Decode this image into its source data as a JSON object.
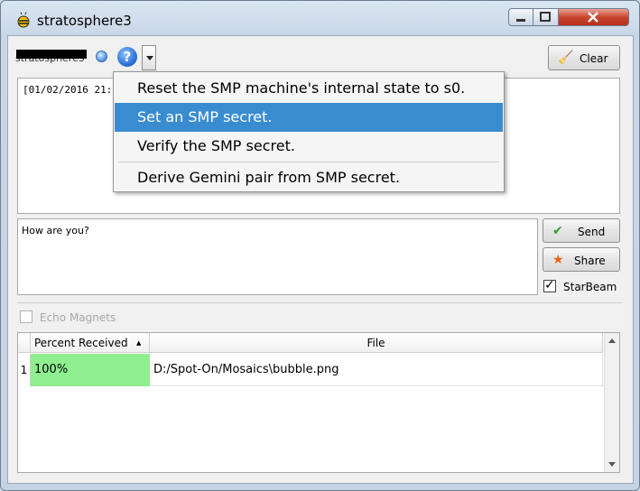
{
  "window": {
    "title": "stratosphere3",
    "controls": [
      "minimize",
      "maximize",
      "close"
    ]
  },
  "toolbar": {
    "participant_name": "stratosphere3",
    "status_icon": "blue-orb-icon",
    "help_icon": "help-icon",
    "clear_label": "Clear"
  },
  "history": {
    "first_line": "[01/02/2016 21:0"
  },
  "compose": {
    "text": "How are you?",
    "send_label": "Send",
    "share_label": "Share",
    "starbeam_label": "StarBeam",
    "starbeam_checked": true
  },
  "echo_magnets": {
    "label": "Echo Magnets",
    "enabled": false
  },
  "table": {
    "columns": [
      "Percent Received",
      "File"
    ],
    "rows": [
      {
        "index": "1",
        "percent": "100%",
        "file": "D:/Spot-On/Mosaics\\bubble.png"
      }
    ]
  },
  "smp_menu": {
    "items": [
      "Reset the SMP machine's internal state to s0.",
      "Set an SMP secret.",
      "Verify the SMP secret.",
      "Derive Gemini pair from SMP secret."
    ],
    "selected_index": 1
  },
  "colors": {
    "menu_highlight": "#3a8cd1",
    "progress_fill": "#8fef8f"
  }
}
